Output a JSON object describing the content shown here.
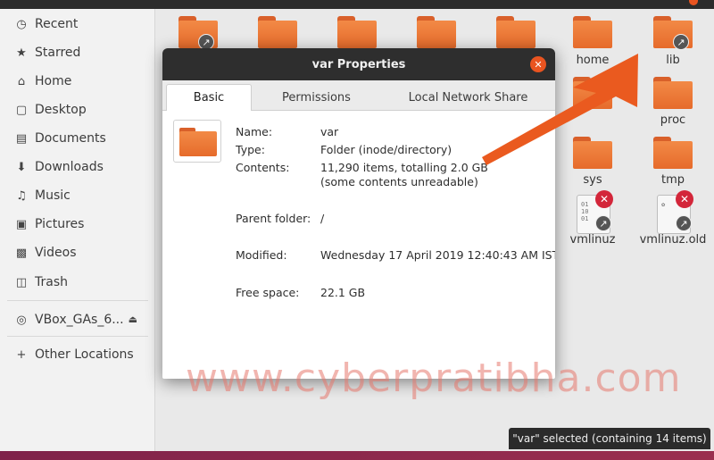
{
  "sidebar": {
    "items": [
      {
        "label": "Recent",
        "icon": "clock-icon"
      },
      {
        "label": "Starred",
        "icon": "star-icon"
      },
      {
        "label": "Home",
        "icon": "home-icon"
      },
      {
        "label": "Desktop",
        "icon": "desktop-icon"
      },
      {
        "label": "Documents",
        "icon": "document-icon"
      },
      {
        "label": "Downloads",
        "icon": "download-icon"
      },
      {
        "label": "Music",
        "icon": "music-icon"
      },
      {
        "label": "Pictures",
        "icon": "picture-icon"
      },
      {
        "label": "Videos",
        "icon": "video-icon"
      },
      {
        "label": "Trash",
        "icon": "trash-icon"
      }
    ],
    "device": {
      "label": "VBox_GAs_6...",
      "icon": "disc-icon"
    },
    "other": {
      "label": "Other Locations",
      "icon": "plus-icon"
    }
  },
  "files": [
    {
      "label": "home"
    },
    {
      "label": "lib"
    },
    {
      "label": "proc"
    },
    {
      "label": "sys"
    },
    {
      "label": "tmp"
    },
    {
      "label": "vmlinuz"
    },
    {
      "label": "vmlinuz.old"
    }
  ],
  "status": {
    "text": "\"var\" selected  (containing 14 items)"
  },
  "dialog": {
    "title": "var Properties",
    "tabs": [
      "Basic",
      "Permissions",
      "Local Network Share"
    ],
    "active_tab": "Basic",
    "props": {
      "name_label": "Name:",
      "name_value": "var",
      "type_label": "Type:",
      "type_value": "Folder (inode/directory)",
      "contents_label": "Contents:",
      "contents_value": "11,290 items, totalling 2.0 GB",
      "contents_note": "(some contents unreadable)",
      "parent_label": "Parent folder:",
      "parent_value": "/",
      "modified_label": "Modified:",
      "modified_value": "Wednesday 17 April 2019 12:40:43 AM IST",
      "free_label": "Free space:",
      "free_value": "22.1 GB"
    }
  },
  "watermark": "www.cyberpratibha.com",
  "colors": {
    "accent": "#e95420",
    "folder": "#ee7a36",
    "arrow": "#ea5a1f"
  }
}
